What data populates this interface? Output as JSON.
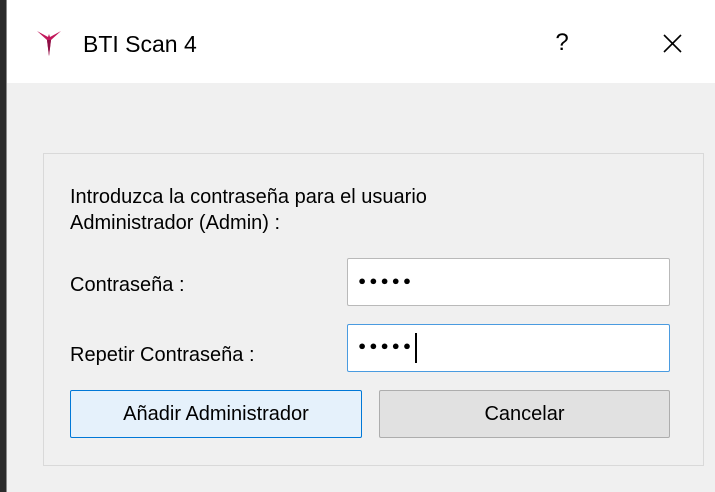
{
  "window": {
    "title": "BTI Scan 4",
    "app_icon": "hummingbird-icon",
    "help_label": "?",
    "close_icon": "close-icon"
  },
  "dialog": {
    "prompt_line1": "Introduzca la contraseña para el usuario",
    "prompt_line2": "Administrador (Admin) :",
    "password_label": "Contraseña :",
    "password_value": "•••••",
    "repeat_label": "Repetir Contraseña :",
    "repeat_value": "•••••",
    "add_button": "Añadir Administrador",
    "cancel_button": "Cancelar"
  },
  "colors": {
    "focus_border": "#4a9be0",
    "default_button_border": "#0078d7",
    "app_icon_color": "#c2185b"
  }
}
